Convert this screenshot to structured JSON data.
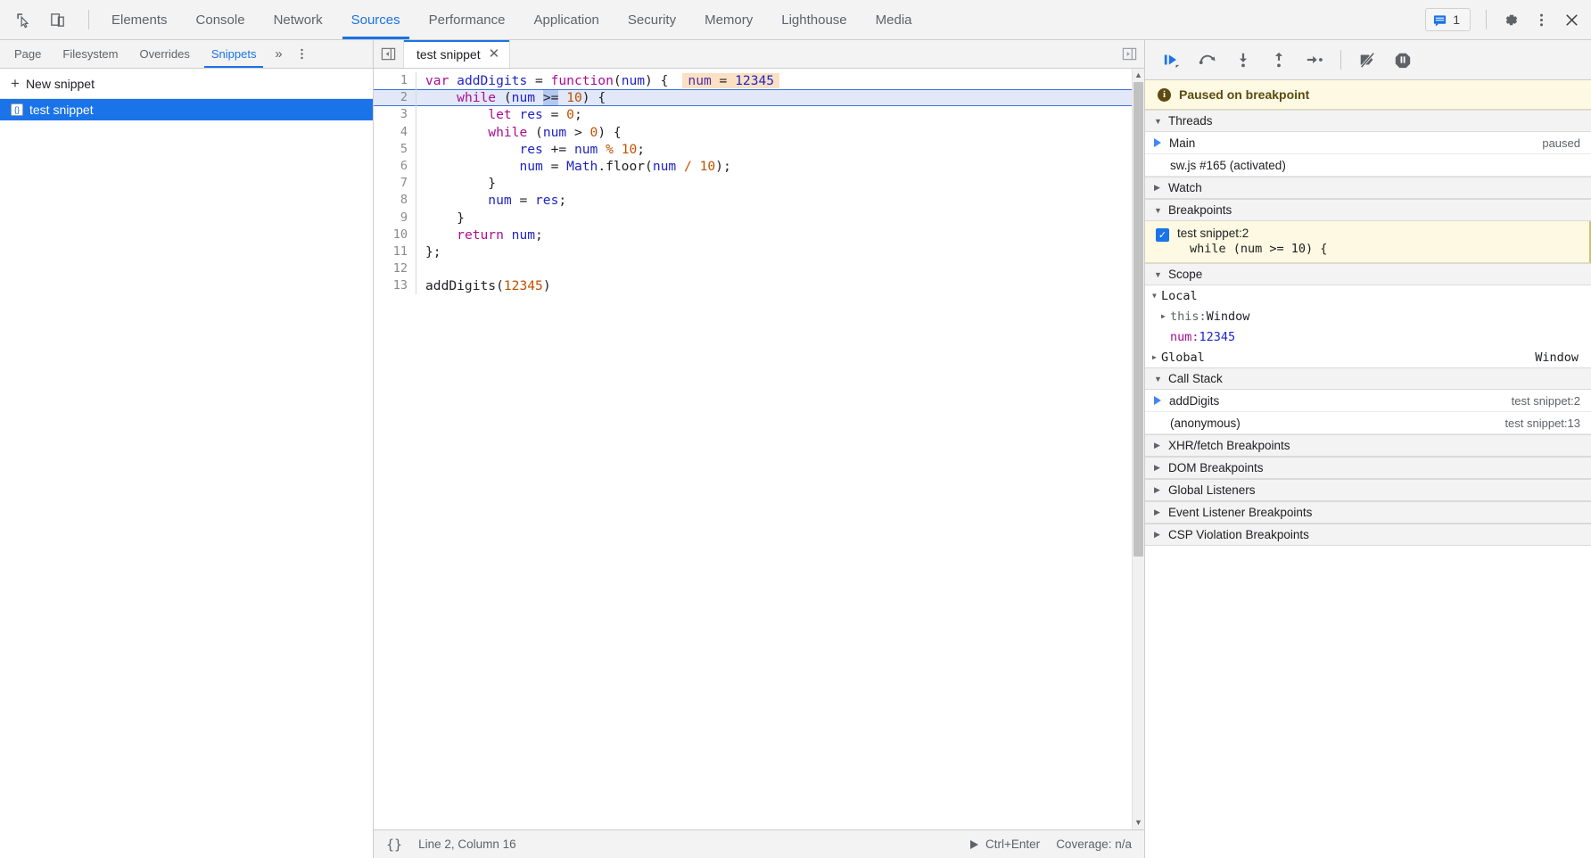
{
  "toolbar": {
    "inspect_icon": "inspect-cursor-icon",
    "device_icon": "device-toolbar-icon",
    "panels": [
      {
        "label": "Elements",
        "active": false
      },
      {
        "label": "Console",
        "active": false
      },
      {
        "label": "Network",
        "active": false
      },
      {
        "label": "Sources",
        "active": true
      },
      {
        "label": "Performance",
        "active": false
      },
      {
        "label": "Application",
        "active": false
      },
      {
        "label": "Security",
        "active": false
      },
      {
        "label": "Memory",
        "active": false
      },
      {
        "label": "Lighthouse",
        "active": false
      },
      {
        "label": "Media",
        "active": false
      }
    ],
    "message_count": "1",
    "settings_icon": "gear-icon",
    "more_icon": "kebab-menu-icon",
    "close_icon": "close-icon",
    "accent_color": "#1a73e8"
  },
  "navigator": {
    "tabs": [
      {
        "label": "Page",
        "active": false
      },
      {
        "label": "Filesystem",
        "active": false
      },
      {
        "label": "Overrides",
        "active": false
      },
      {
        "label": "Snippets",
        "active": true
      }
    ],
    "more_label": "»",
    "new_snippet_label": "New snippet",
    "items": [
      {
        "label": "test snippet",
        "selected": true,
        "badge": "{}"
      }
    ]
  },
  "editor": {
    "collapse_icon": "collapse-sidebar-icon",
    "tab_label": "test snippet",
    "close_icon": "close-icon",
    "drawer_icon": "show-drawer-icon",
    "inline_value": {
      "name": "num",
      "eq": " = ",
      "value": "12345"
    },
    "lines": [
      {
        "n": "1",
        "highlight": false,
        "tokens": [
          {
            "t": "var",
            "c": "kw"
          },
          {
            "t": " ",
            "c": "plain"
          },
          {
            "t": "addDigits",
            "c": "var"
          },
          {
            "t": " = ",
            "c": "op"
          },
          {
            "t": "function",
            "c": "kw"
          },
          {
            "t": "(",
            "c": "plain"
          },
          {
            "t": "num",
            "c": "var"
          },
          {
            "t": ") {",
            "c": "plain"
          }
        ]
      },
      {
        "n": "2",
        "highlight": true,
        "tokens": [
          {
            "t": "    ",
            "c": "plain"
          },
          {
            "t": "while",
            "c": "kw"
          },
          {
            "t": " (",
            "c": "plain"
          },
          {
            "t": "num",
            "c": "var"
          },
          {
            "t": " ",
            "c": "plain"
          },
          {
            "t": ">=",
            "c": "sel"
          },
          {
            "t": " ",
            "c": "plain"
          },
          {
            "t": "10",
            "c": "num"
          },
          {
            "t": ") {",
            "c": "plain"
          }
        ]
      },
      {
        "n": "3",
        "highlight": false,
        "tokens": [
          {
            "t": "        ",
            "c": "plain"
          },
          {
            "t": "let",
            "c": "kw"
          },
          {
            "t": " ",
            "c": "plain"
          },
          {
            "t": "res",
            "c": "var"
          },
          {
            "t": " = ",
            "c": "op"
          },
          {
            "t": "0",
            "c": "num"
          },
          {
            "t": ";",
            "c": "plain"
          }
        ]
      },
      {
        "n": "4",
        "highlight": false,
        "tokens": [
          {
            "t": "        ",
            "c": "plain"
          },
          {
            "t": "while",
            "c": "kw"
          },
          {
            "t": " (",
            "c": "plain"
          },
          {
            "t": "num",
            "c": "var"
          },
          {
            "t": " > ",
            "c": "op"
          },
          {
            "t": "0",
            "c": "num"
          },
          {
            "t": ") {",
            "c": "plain"
          }
        ]
      },
      {
        "n": "5",
        "highlight": false,
        "tokens": [
          {
            "t": "            ",
            "c": "plain"
          },
          {
            "t": "res",
            "c": "var"
          },
          {
            "t": " += ",
            "c": "op"
          },
          {
            "t": "num",
            "c": "var"
          },
          {
            "t": " ",
            "c": "plain"
          },
          {
            "t": "%",
            "c": "num"
          },
          {
            "t": " ",
            "c": "plain"
          },
          {
            "t": "10",
            "c": "num"
          },
          {
            "t": ";",
            "c": "plain"
          }
        ]
      },
      {
        "n": "6",
        "highlight": false,
        "tokens": [
          {
            "t": "            ",
            "c": "plain"
          },
          {
            "t": "num",
            "c": "var"
          },
          {
            "t": " = ",
            "c": "op"
          },
          {
            "t": "Math",
            "c": "var"
          },
          {
            "t": ".",
            "c": "plain"
          },
          {
            "t": "floor",
            "c": "plain"
          },
          {
            "t": "(",
            "c": "plain"
          },
          {
            "t": "num",
            "c": "var"
          },
          {
            "t": " ",
            "c": "plain"
          },
          {
            "t": "/",
            "c": "num"
          },
          {
            "t": " ",
            "c": "plain"
          },
          {
            "t": "10",
            "c": "num"
          },
          {
            "t": ");",
            "c": "plain"
          }
        ]
      },
      {
        "n": "7",
        "highlight": false,
        "tokens": [
          {
            "t": "        }",
            "c": "plain"
          }
        ]
      },
      {
        "n": "8",
        "highlight": false,
        "tokens": [
          {
            "t": "        ",
            "c": "plain"
          },
          {
            "t": "num",
            "c": "var"
          },
          {
            "t": " = ",
            "c": "op"
          },
          {
            "t": "res",
            "c": "var"
          },
          {
            "t": ";",
            "c": "plain"
          }
        ]
      },
      {
        "n": "9",
        "highlight": false,
        "tokens": [
          {
            "t": "    }",
            "c": "plain"
          }
        ]
      },
      {
        "n": "10",
        "highlight": false,
        "tokens": [
          {
            "t": "    ",
            "c": "plain"
          },
          {
            "t": "return",
            "c": "kw"
          },
          {
            "t": " ",
            "c": "plain"
          },
          {
            "t": "num",
            "c": "var"
          },
          {
            "t": ";",
            "c": "plain"
          }
        ]
      },
      {
        "n": "11",
        "highlight": false,
        "tokens": [
          {
            "t": "};",
            "c": "plain"
          }
        ]
      },
      {
        "n": "12",
        "highlight": false,
        "tokens": [
          {
            "t": "",
            "c": "plain"
          }
        ]
      },
      {
        "n": "13",
        "highlight": false,
        "tokens": [
          {
            "t": "addDigits",
            "c": "plain"
          },
          {
            "t": "(",
            "c": "plain"
          },
          {
            "t": "12345",
            "c": "num"
          },
          {
            "t": ")",
            "c": "plain"
          }
        ]
      }
    ],
    "status": {
      "pretty_print": "{}",
      "cursor": "Line 2, Column 16",
      "run_shortcut": "Ctrl+Enter",
      "coverage": "Coverage: n/a"
    }
  },
  "debugger": {
    "controls": [
      {
        "name": "resume-script-execution",
        "icon": "resume-icon"
      },
      {
        "name": "step-over-next-function-call",
        "icon": "step-over-icon"
      },
      {
        "name": "step-into-next-function-call",
        "icon": "step-into-icon"
      },
      {
        "name": "step-out-of-current-function",
        "icon": "step-out-icon"
      },
      {
        "name": "step",
        "icon": "step-icon"
      },
      {
        "name": "deactivate-breakpoints",
        "icon": "deactivate-breakpoints-icon"
      },
      {
        "name": "pause-on-exceptions",
        "icon": "pause-on-exceptions-icon"
      }
    ],
    "paused_banner": "Paused on breakpoint",
    "threads": {
      "title": "Threads",
      "rows": [
        {
          "label": "Main",
          "right": "paused",
          "current": true
        },
        {
          "label": "sw.js #165 (activated)",
          "right": "",
          "current": false
        }
      ]
    },
    "watch": {
      "title": "Watch"
    },
    "breakpoints": {
      "title": "Breakpoints",
      "items": [
        {
          "checked": true,
          "location": "test snippet:2",
          "code": "while (num >= 10) {"
        }
      ]
    },
    "scope": {
      "title": "Scope",
      "rows": [
        {
          "tri": "▼",
          "name": "Local",
          "value": "",
          "style": "plain",
          "indent": 0
        },
        {
          "tri": "▶",
          "name": "this:",
          "value": " Window",
          "style": "dim",
          "indent": 1
        },
        {
          "tri": "",
          "name": "num:",
          "value": " 12345",
          "style": "prop",
          "indent": 1
        },
        {
          "tri": "▶",
          "name": "Global",
          "value": "",
          "style": "plain",
          "indent": 0,
          "right": "Window"
        }
      ]
    },
    "call_stack": {
      "title": "Call Stack",
      "frames": [
        {
          "label": "addDigits",
          "location": "test snippet:2",
          "current": true
        },
        {
          "label": "(anonymous)",
          "location": "test snippet:13",
          "current": false
        }
      ]
    },
    "collapsed_sections": [
      {
        "title": "XHR/fetch Breakpoints"
      },
      {
        "title": "DOM Breakpoints"
      },
      {
        "title": "Global Listeners"
      },
      {
        "title": "Event Listener Breakpoints"
      },
      {
        "title": "CSP Violation Breakpoints"
      }
    ]
  }
}
